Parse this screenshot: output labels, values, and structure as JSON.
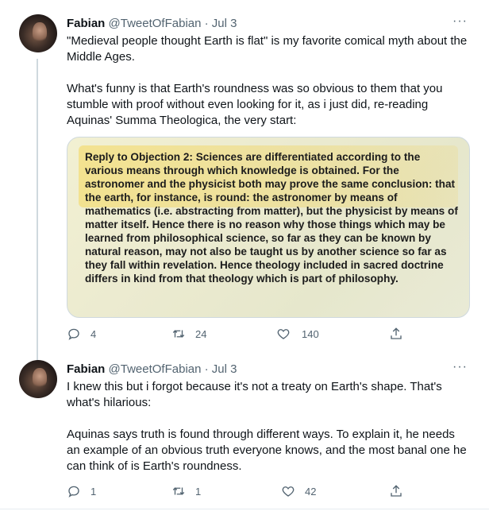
{
  "tweets": [
    {
      "name": "Fabian",
      "handle": "@TweetOfFabian",
      "date": "· Jul 3",
      "more": "···",
      "paragraphs": [
        "\"Medieval people thought Earth is flat\" is my favorite comical myth about the Middle Ages.",
        "What's funny is that Earth's roundness was so obvious to them that you stumble with proof without even looking for it, as i just did, re-reading Aquinas' Summa Theologica, the very start:"
      ],
      "media_text": "Reply to Objection 2: Sciences are differentiated according to the various means through which knowledge is obtained. For the astronomer and the physicist both may prove the same conclusion: that the earth, for instance, is round: the astronomer by means of mathematics (i.e. abstracting from matter), but the physicist by means of matter itself. Hence there is no reason why those things which may be learned from philosophical science, so far as they can be known by natural reason, may not also be taught us by another science so far as they fall within revelation. Hence theology included in sacred doctrine differs in kind from that theology which is part of philosophy.",
      "replies": "4",
      "retweets": "24",
      "likes": "140"
    },
    {
      "name": "Fabian",
      "handle": "@TweetOfFabian",
      "date": "· Jul 3",
      "more": "···",
      "paragraphs": [
        "I knew this but i forgot because it's not a treaty on Earth's shape. That's what's hilarious:",
        "Aquinas says truth is found through different ways. To explain it, he needs an example of an obvious truth everyone knows, and the most banal one he can think of is Earth's roundness."
      ],
      "replies": "1",
      "retweets": "1",
      "likes": "42"
    }
  ],
  "icons": {
    "reply": "reply-icon",
    "retweet": "retweet-icon",
    "like": "heart-icon",
    "share": "share-icon"
  },
  "colors": {
    "text": "#0f1419",
    "secondary": "#536471",
    "border": "#cfd9de",
    "highlight": "#f5d75a"
  }
}
